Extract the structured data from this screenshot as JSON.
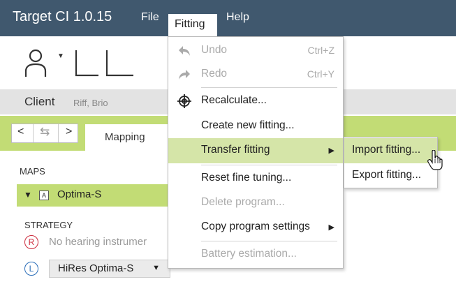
{
  "app": {
    "title": "Target CI 1.0.15"
  },
  "menubar": {
    "items": [
      "File",
      "Fitting",
      "Help"
    ]
  },
  "client": {
    "label": "Client",
    "name": "Riff, Brio"
  },
  "tabs": {
    "active": "Mapping"
  },
  "maps": {
    "heading": "MAPS",
    "selected_badge": "A",
    "selected": "Optima-S"
  },
  "strategy": {
    "heading": "STRATEGY",
    "right_badge": "R",
    "right_text": "No hearing instrumer",
    "left_badge": "L",
    "left_value": "HiRes Optima-S"
  },
  "fitting_menu": {
    "items": [
      {
        "label": "Undo",
        "shortcut": "Ctrl+Z",
        "icon": "undo-icon",
        "enabled": false
      },
      {
        "label": "Redo",
        "shortcut": "Ctrl+Y",
        "icon": "redo-icon",
        "enabled": false
      },
      {
        "label": "Recalculate...",
        "icon": "target-icon",
        "enabled": true
      },
      {
        "label": "Create new fitting...",
        "enabled": true
      },
      {
        "label": "Transfer fitting",
        "has_submenu": true,
        "enabled": true,
        "highlighted": true
      },
      {
        "label": "Reset fine tuning...",
        "enabled": true
      },
      {
        "label": "Delete program...",
        "enabled": false
      },
      {
        "label": "Copy program settings",
        "has_submenu": true,
        "enabled": true
      },
      {
        "label": "Battery estimation...",
        "enabled": false
      }
    ]
  },
  "transfer_submenu": {
    "items": [
      {
        "label": "Import fitting...",
        "highlighted": true
      },
      {
        "label": "Export fitting..."
      }
    ]
  },
  "colors": {
    "titlebar": "#40586e",
    "accent_green": "#c2dc75",
    "menu_highlight": "#d5e5a8",
    "right_ear": "#cc2b3c",
    "left_ear": "#2a6db8"
  }
}
